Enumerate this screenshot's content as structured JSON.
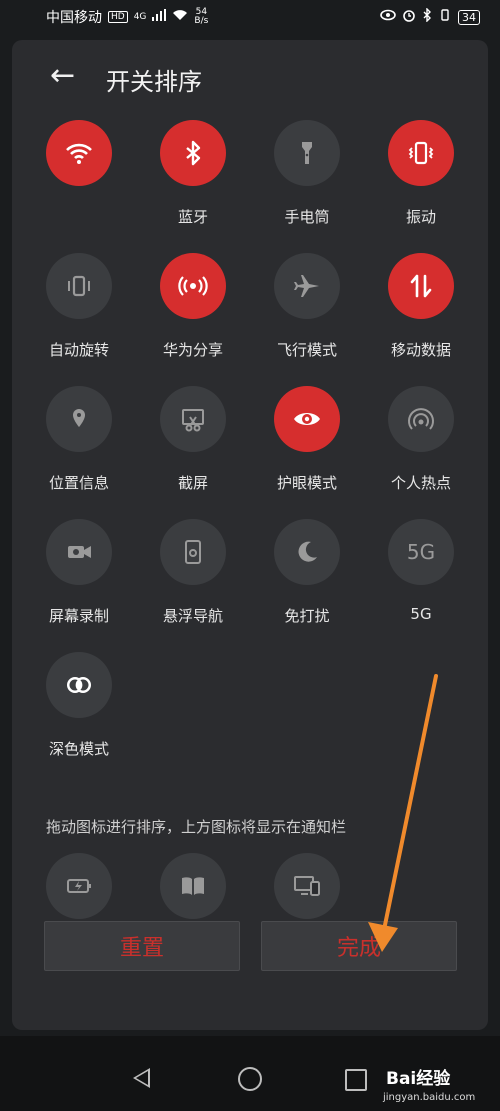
{
  "status_bar": {
    "carrier": "中国移动",
    "hd": "HD",
    "net": "4G",
    "speed_value": "54",
    "speed_unit": "B/s",
    "battery": "34"
  },
  "header": {
    "title": "开关排序"
  },
  "toggles": [
    {
      "label": "",
      "icon": "wifi-icon",
      "active": true
    },
    {
      "label": "蓝牙",
      "icon": "bluetooth-icon",
      "active": true
    },
    {
      "label": "手电筒",
      "icon": "flashlight-icon",
      "active": false
    },
    {
      "label": "振动",
      "icon": "vibrate-icon",
      "active": true
    },
    {
      "label": "自动旋转",
      "icon": "auto-rotate-icon",
      "active": false
    },
    {
      "label": "华为分享",
      "icon": "huawei-share-icon",
      "active": true
    },
    {
      "label": "飞行模式",
      "icon": "airplane-icon",
      "active": false
    },
    {
      "label": "移动数据",
      "icon": "mobile-data-icon",
      "active": true
    },
    {
      "label": "位置信息",
      "icon": "location-icon",
      "active": false
    },
    {
      "label": "截屏",
      "icon": "screenshot-icon",
      "active": false
    },
    {
      "label": "护眼模式",
      "icon": "eye-icon",
      "active": true
    },
    {
      "label": "个人热点",
      "icon": "hotspot-icon",
      "active": false
    },
    {
      "label": "屏幕录制",
      "icon": "screen-record-icon",
      "active": false
    },
    {
      "label": "悬浮导航",
      "icon": "floating-nav-icon",
      "active": false
    },
    {
      "label": "免打扰",
      "icon": "moon-icon",
      "active": false
    },
    {
      "label": "5G",
      "icon": "5g-icon",
      "icon_text": "5G",
      "active": false
    },
    {
      "label": "深色模式",
      "icon": "dark-mode-icon",
      "active": false
    }
  ],
  "hint": "拖动图标进行排序，上方图标将显示在通知栏",
  "extra_toggles": [
    {
      "icon": "battery-saver-icon"
    },
    {
      "icon": "reading-mode-icon"
    },
    {
      "icon": "multi-screen-icon"
    }
  ],
  "buttons": {
    "reset": "重置",
    "done": "完成"
  },
  "watermark": {
    "brand": "Bai经验",
    "url": "jingyan.baidu.com"
  },
  "colors": {
    "active": "#d62e2e",
    "inactive": "#3b3d40",
    "panel": "#2b2c2f",
    "arrow": "#f08a2c"
  }
}
